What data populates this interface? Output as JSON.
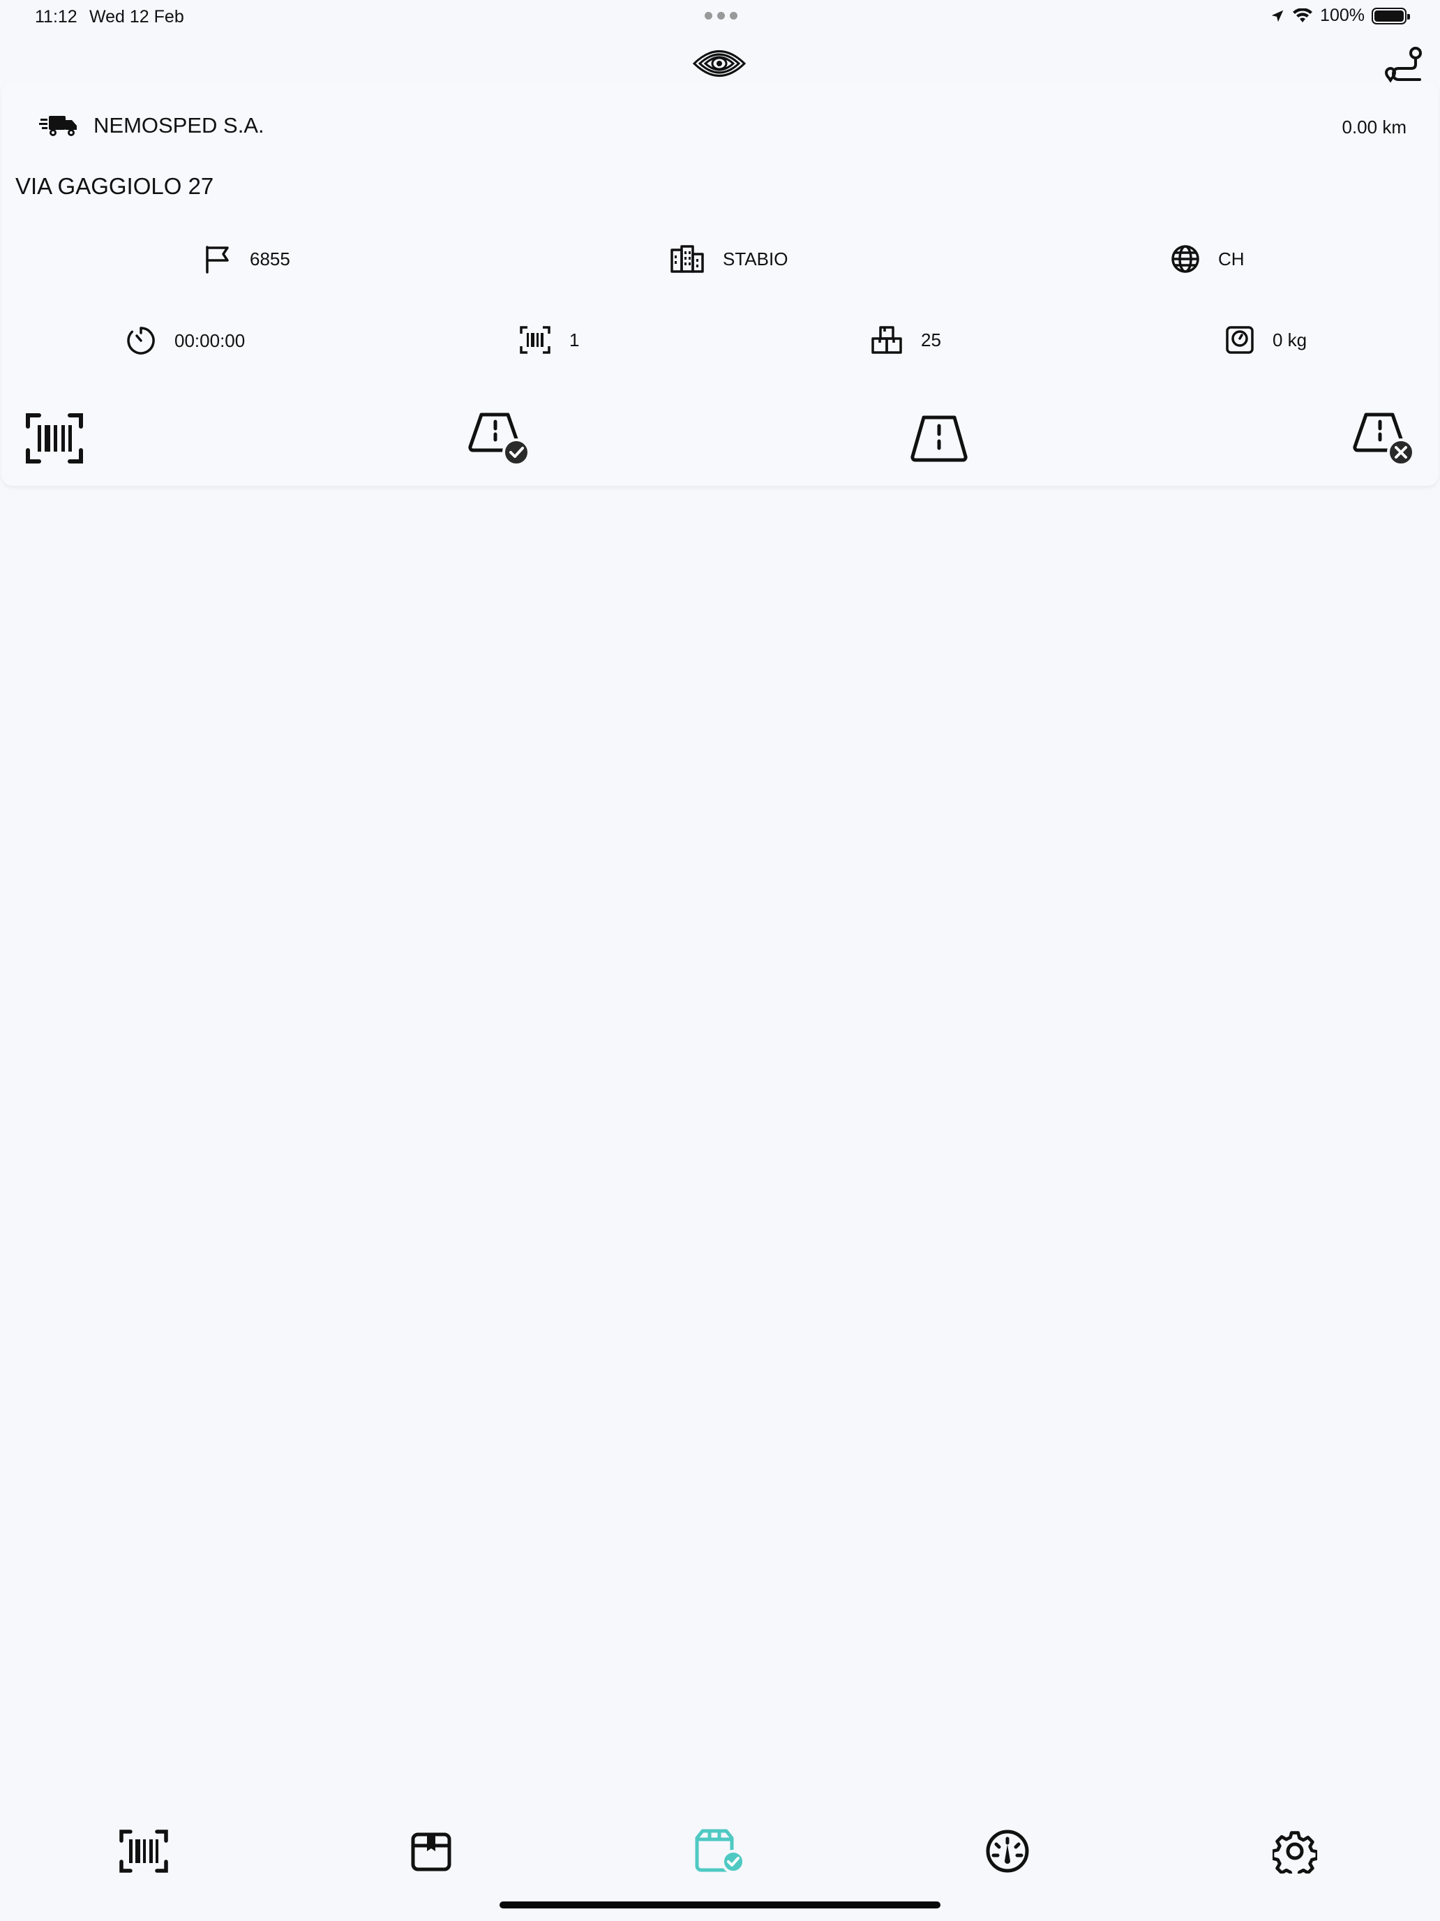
{
  "status_bar": {
    "time": "11:12",
    "date": "Wed 12 Feb",
    "battery": "100%"
  },
  "header": {
    "logo_icon": "eye-logo-icon",
    "route_icon": "route-icon"
  },
  "stop": {
    "customer": "NEMOSPED S.A.",
    "distance": "0.00 km",
    "address": "VIA GAGGIOLO 27",
    "zip": "6855",
    "city": "STABIO",
    "country": "CH",
    "timer": "00:00:00",
    "barcodes": "1",
    "packages": "25",
    "weight": "0 kg"
  },
  "actions": [
    "scan-barcode-icon",
    "delivery-ok-icon",
    "delivery-warning-icon",
    "delivery-failed-icon"
  ],
  "bottom_nav": {
    "items": [
      "scan",
      "packages",
      "deliveries",
      "dashboard",
      "settings"
    ],
    "active": "deliveries",
    "active_color": "#4ec9c2"
  }
}
